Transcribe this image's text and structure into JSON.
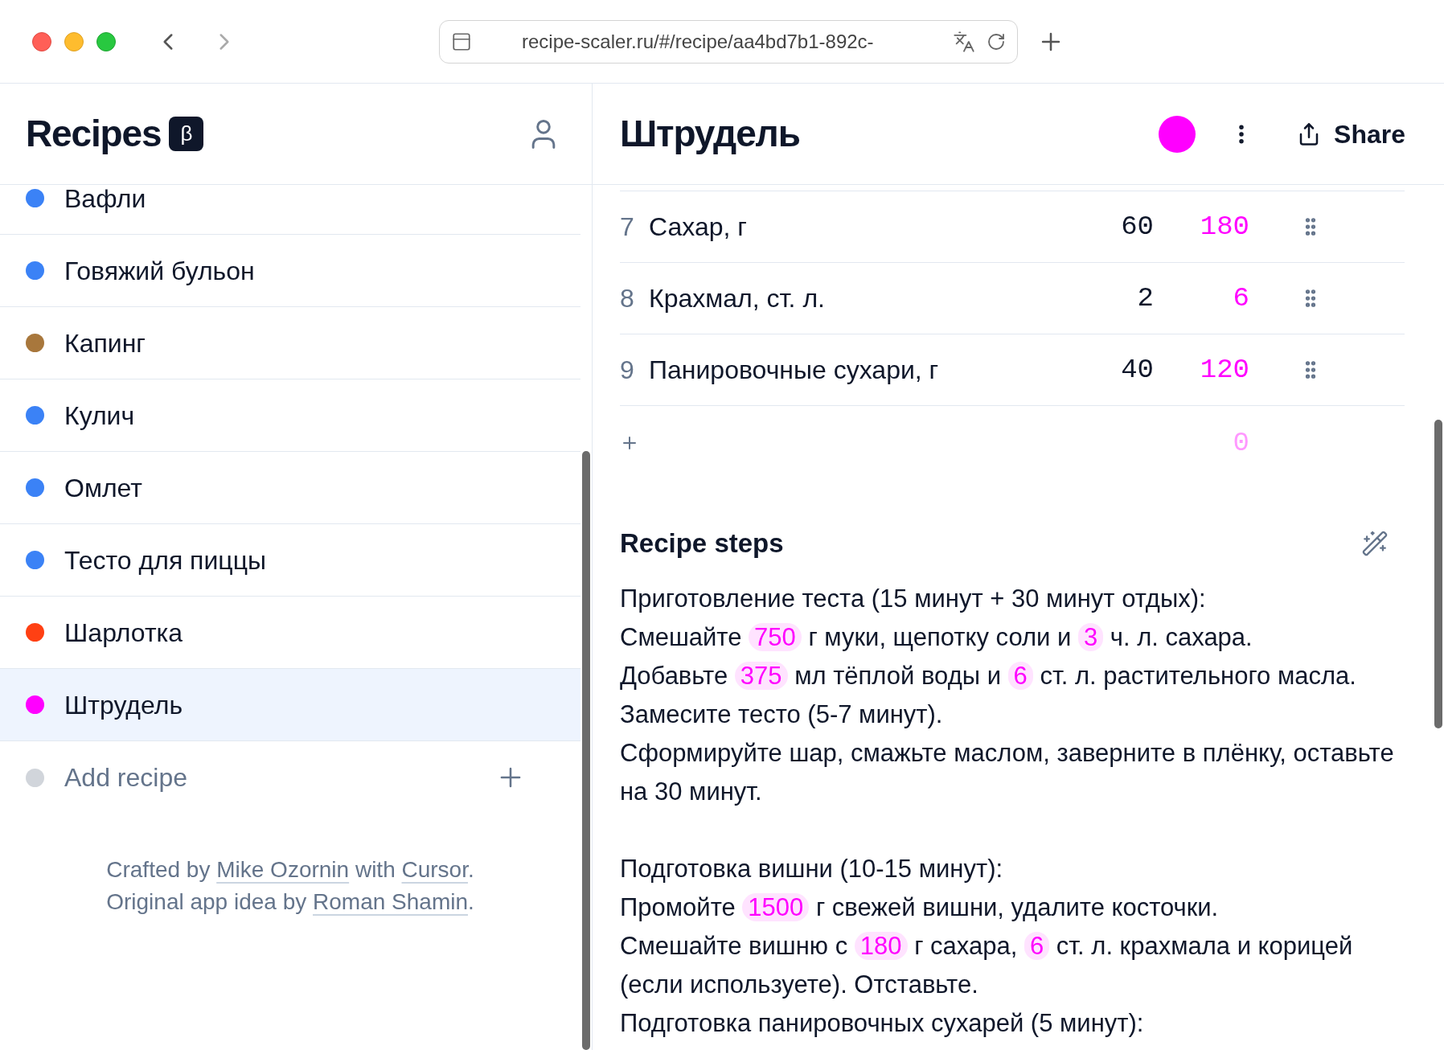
{
  "browser": {
    "url": "recipe-scaler.ru/#/recipe/aa4bd7b1-892c-"
  },
  "sidebar": {
    "title": "Recipes",
    "badge": "β",
    "items": [
      {
        "name": "Вафли",
        "color": "#3b82f6",
        "selected": false
      },
      {
        "name": "Говяжий бульон",
        "color": "#3b82f6",
        "selected": false
      },
      {
        "name": "Капинг",
        "color": "#a8773c",
        "selected": false
      },
      {
        "name": "Кулич",
        "color": "#3b82f6",
        "selected": false
      },
      {
        "name": "Омлет",
        "color": "#3b82f6",
        "selected": false
      },
      {
        "name": "Тесто для пиццы",
        "color": "#3b82f6",
        "selected": false
      },
      {
        "name": "Шарлотка",
        "color": "#ff4013",
        "selected": false
      },
      {
        "name": "Штрудель",
        "color": "#ff00ff",
        "selected": true
      }
    ],
    "add_label": "Add recipe",
    "footer": [
      [
        {
          "text": "Crafted by ",
          "kind": "text"
        },
        {
          "text": "Mike Ozornin",
          "kind": "link"
        },
        {
          "text": " with ",
          "kind": "text"
        },
        {
          "text": "Cursor",
          "kind": "link"
        },
        {
          "text": ".",
          "kind": "text"
        }
      ],
      [
        {
          "text": "Original app idea by ",
          "kind": "text"
        },
        {
          "text": "Roman Shamin",
          "kind": "link"
        },
        {
          "text": ".",
          "kind": "text"
        }
      ]
    ]
  },
  "recipe": {
    "title": "Штрудель",
    "color": "#ff00ff",
    "share_label": "Share",
    "ingredients": [
      {
        "number": "7",
        "name": "Сахар, г",
        "amount": "60",
        "scaled": "180"
      },
      {
        "number": "8",
        "name": "Крахмал, ст. л.",
        "amount": "2",
        "scaled": "6"
      },
      {
        "number": "9",
        "name": "Панировочные сухари, г",
        "amount": "40",
        "scaled": "120"
      }
    ],
    "new_row_scaled": "0",
    "steps_title": "Recipe steps",
    "steps": [
      [
        [
          {
            "text": "Приготовление теста (15 минут + 30 минут отдых):",
            "kind": "text"
          }
        ],
        [
          {
            "text": "Смешайте ",
            "kind": "text"
          },
          {
            "text": "750",
            "kind": "value"
          },
          {
            "text": " г муки, щепотку соли и ",
            "kind": "text"
          },
          {
            "text": "3",
            "kind": "value"
          },
          {
            "text": " ч. л. сахара.",
            "kind": "text"
          }
        ],
        [
          {
            "text": "Добавьте ",
            "kind": "text"
          },
          {
            "text": "375",
            "kind": "value"
          },
          {
            "text": " мл тёплой воды и ",
            "kind": "text"
          },
          {
            "text": "6",
            "kind": "value"
          },
          {
            "text": " ст. л. растительного масла. Замесите тесто (5-7 минут).",
            "kind": "text"
          }
        ],
        [
          {
            "text": "Сформируйте шар, смажьте маслом, заверните в плёнку, оставьте на 30 минут.",
            "kind": "text"
          }
        ]
      ],
      [
        [
          {
            "text": "Подготовка вишни (10-15 минут):",
            "kind": "text"
          }
        ],
        [
          {
            "text": "Промойте ",
            "kind": "text"
          },
          {
            "text": "1500",
            "kind": "value"
          },
          {
            "text": " г свежей вишни, удалите косточки.",
            "kind": "text"
          }
        ],
        [
          {
            "text": "Смешайте вишню с ",
            "kind": "text"
          },
          {
            "text": "180",
            "kind": "value"
          },
          {
            "text": " г сахара, ",
            "kind": "text"
          },
          {
            "text": "6",
            "kind": "value"
          },
          {
            "text": " ст. л. крахмала и корицей (если используете). Отставьте.",
            "kind": "text"
          }
        ],
        [
          {
            "text": "Подготовка панировочных сухарей (5 минут):",
            "kind": "text"
          }
        ]
      ]
    ]
  }
}
